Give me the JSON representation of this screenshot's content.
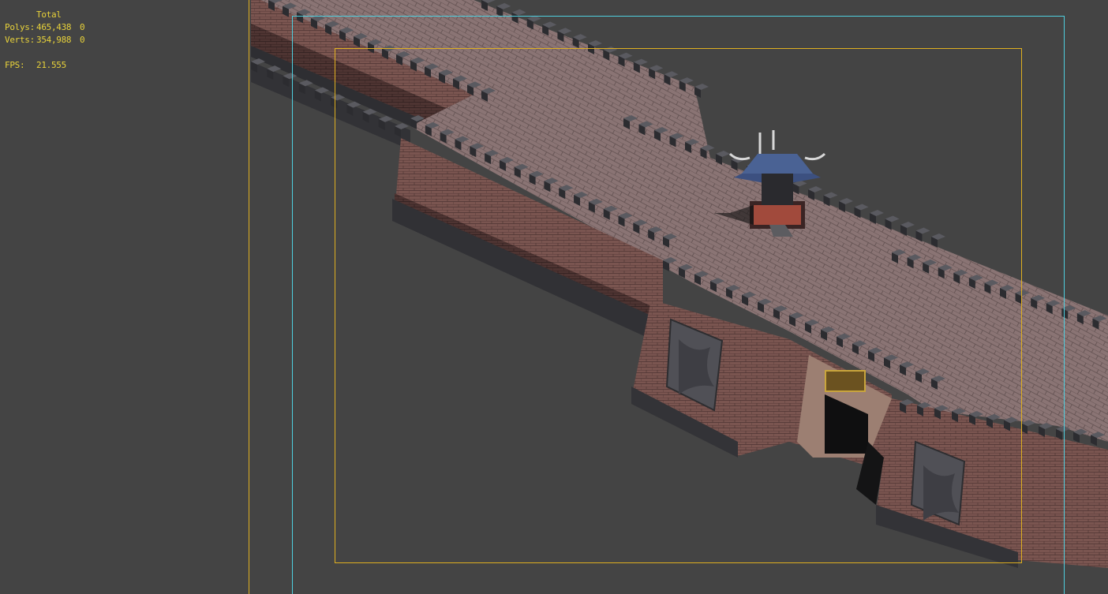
{
  "stats": {
    "header": "Total",
    "polys_label": "Polys:",
    "polys_total": "465,438",
    "polys_selected": "0",
    "verts_label": "Verts:",
    "verts_total": "354,988",
    "verts_selected": "0",
    "fps_label": "FPS:",
    "fps_value": "21.555"
  },
  "colors": {
    "viewport_bg": "#444444",
    "stats_text": "#e8d23a",
    "safe_frame_outer": "#e0b020",
    "safe_frame_action": "#4fd0e0",
    "safe_frame_title": "#e0b020"
  }
}
